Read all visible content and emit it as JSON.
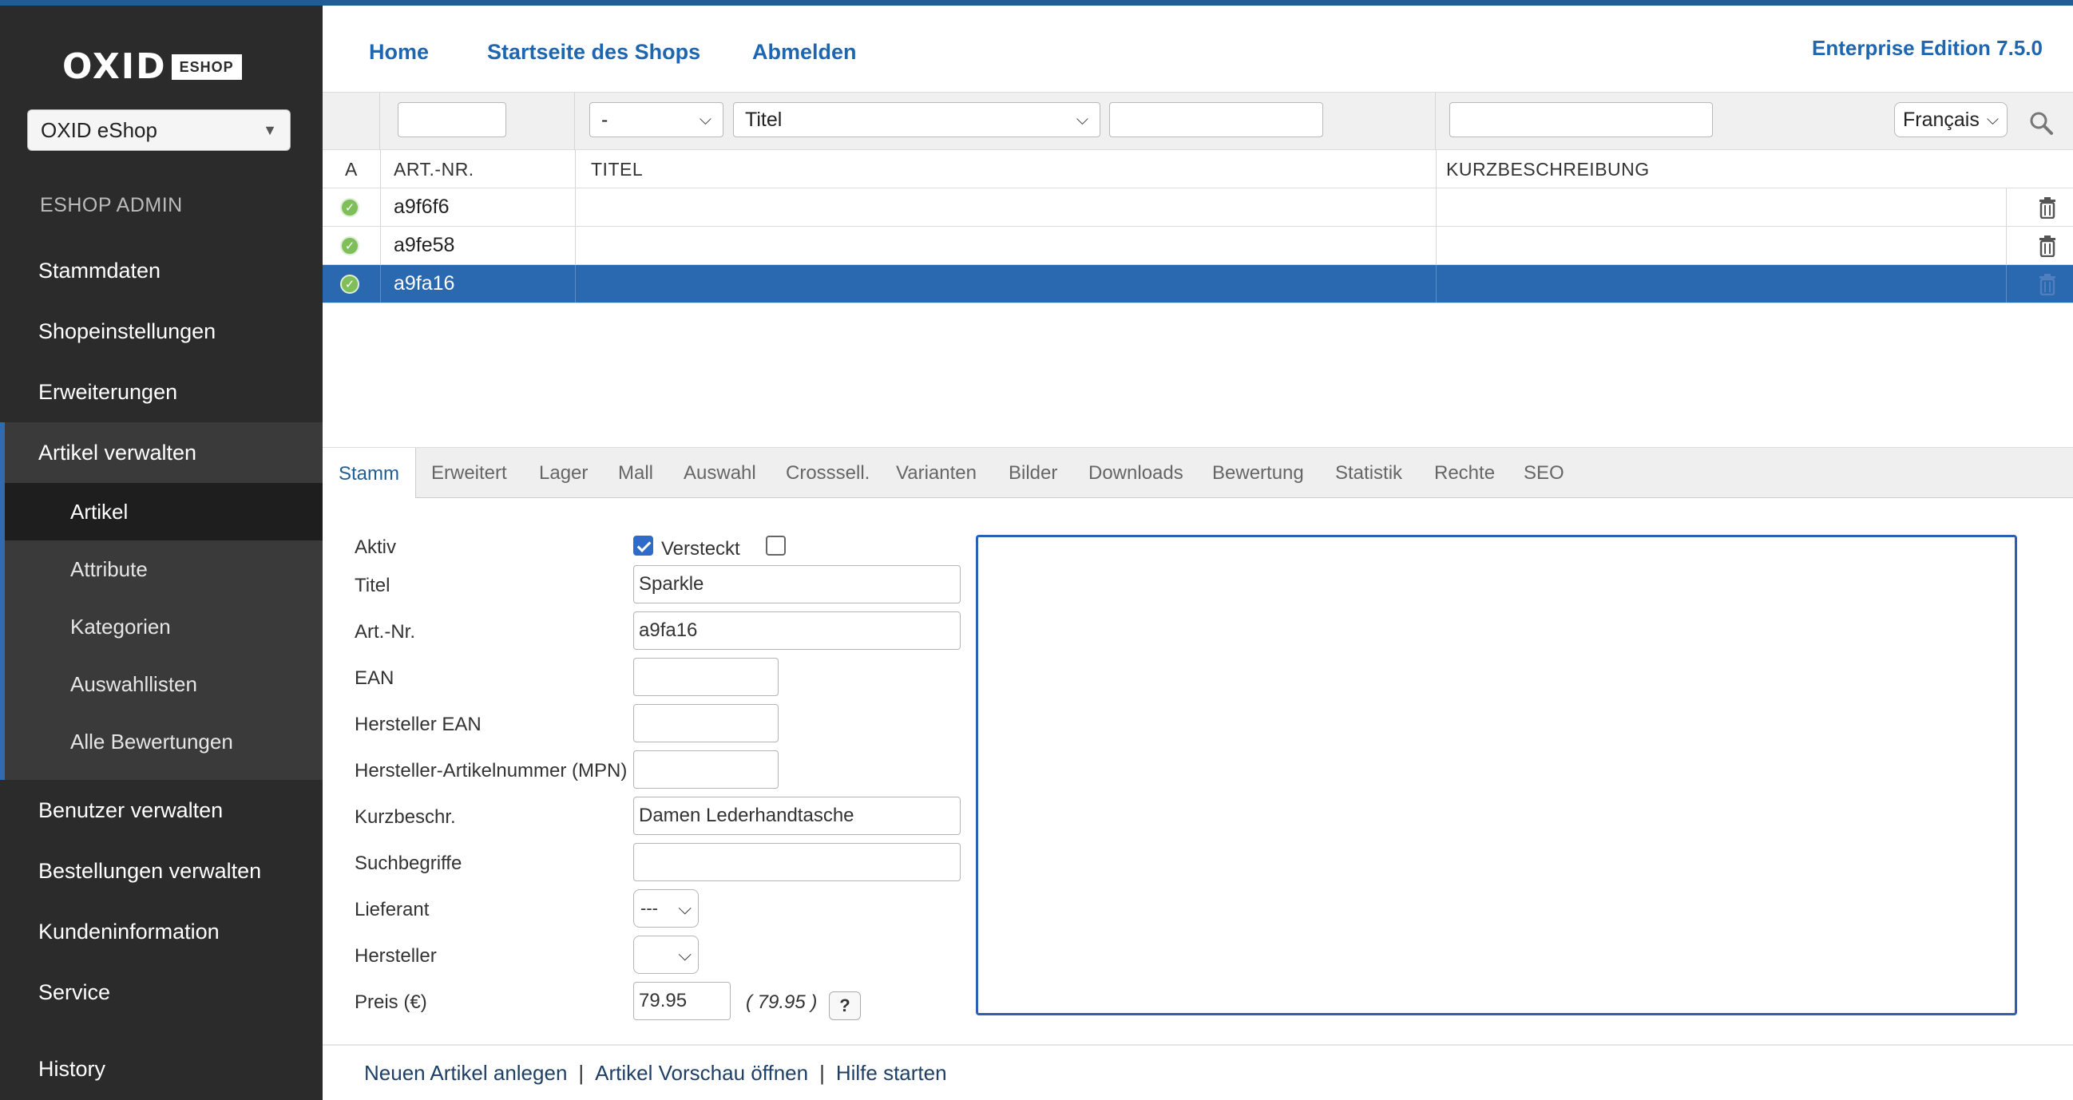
{
  "sidebar": {
    "logo_main": "OXID",
    "logo_badge": "ESHOP",
    "shop_select": "OXID eShop",
    "admin_label": "ESHOP ADMIN",
    "items": [
      {
        "label": "Stammdaten"
      },
      {
        "label": "Shopeinstellungen"
      },
      {
        "label": "Erweiterungen"
      }
    ],
    "group": {
      "label": "Artikel verwalten",
      "subitems": [
        {
          "label": "Artikel"
        },
        {
          "label": "Attribute"
        },
        {
          "label": "Kategorien"
        },
        {
          "label": "Auswahllisten"
        },
        {
          "label": "Alle Bewertungen"
        }
      ]
    },
    "items_after": [
      {
        "label": "Benutzer verwalten"
      },
      {
        "label": "Bestellungen verwalten"
      },
      {
        "label": "Kundeninformation"
      },
      {
        "label": "Service"
      },
      {
        "label": "History"
      }
    ]
  },
  "header": {
    "links": [
      "Home",
      "Startseite des Shops",
      "Abmelden"
    ],
    "edition": "Enterprise Edition 7.5.0"
  },
  "filter": {
    "artnr_value": "",
    "type_select": "-",
    "field_select": "Titel",
    "title_value": "",
    "short_value": "",
    "language": "Français"
  },
  "table": {
    "headers": {
      "active": "A",
      "artnr": "ART.-NR.",
      "title": "TITEL",
      "short": "KURZBESCHREIBUNG"
    },
    "rows": [
      {
        "artnr": "a9f6f6",
        "title": "",
        "short": ""
      },
      {
        "artnr": "a9fe58",
        "title": "",
        "short": ""
      },
      {
        "artnr": "a9fa16",
        "title": "",
        "short": ""
      }
    ]
  },
  "tabs": [
    "Stamm",
    "Erweitert",
    "Lager",
    "Mall",
    "Auswahl",
    "Crosssell.",
    "Varianten",
    "Bilder",
    "Downloads",
    "Bewertung",
    "Statistik",
    "Rechte",
    "SEO"
  ],
  "form": {
    "labels": {
      "aktiv": "Aktiv",
      "versteckt": "Versteckt",
      "titel": "Titel",
      "artnr": "Art.-Nr.",
      "ean": "EAN",
      "hersteller_ean": "Hersteller EAN",
      "mpn": "Hersteller-Artikelnummer (MPN)",
      "kurzbeschr": "Kurzbeschr.",
      "suchbegriffe": "Suchbegriffe",
      "lieferant": "Lieferant",
      "hersteller": "Hersteller",
      "preis": "Preis (€)"
    },
    "values": {
      "titel": "Sparkle",
      "artnr": "a9fa16",
      "ean": "",
      "hersteller_ean": "",
      "mpn": "",
      "kurzbeschr": "Damen Lederhandtasche",
      "suchbegriffe": "",
      "lieferant": "---",
      "hersteller": "",
      "preis": "79.95",
      "preis_brutto": "( 79.95 )",
      "help": "?"
    }
  },
  "footer": {
    "links": [
      "Neuen Artikel anlegen",
      "Artikel Vorschau öffnen",
      "Hilfe starten"
    ]
  }
}
